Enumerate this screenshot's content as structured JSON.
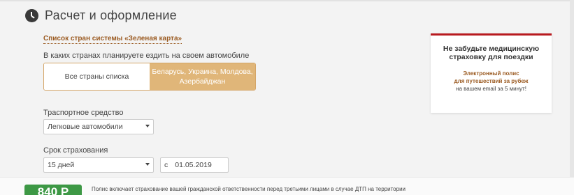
{
  "header": {
    "icon": "clock-icon",
    "title": "Расчет и оформление"
  },
  "countries_link": "Список стран системы «Зеленая карта»",
  "countries": {
    "label": "В каких странах планируете ездить на своем автомобиле",
    "options": [
      "Все страны списка",
      "Беларусь, Украина, Молдова, Азербайджан"
    ],
    "selected_index": 1
  },
  "vehicle": {
    "label": "Траспортное средство",
    "value": "Легковые автомобили"
  },
  "period": {
    "label": "Срок страхования",
    "value": "15 дней",
    "date_prefix": "с",
    "date_value": "01.05.2019"
  },
  "promo": {
    "title": "Не забудьте медицинскую страховку для поездки",
    "line1": "Электронный полис",
    "line2": "для путешествий за рубеж",
    "line3": "на вашем email за 5 минут!"
  },
  "footer": {
    "price": "840 Р",
    "note": "Полис включает страхование вашей гражданской ответственности перед третьими лицами в случае ДТП на территории"
  },
  "colors": {
    "accent": "#e0b679",
    "link": "#9b5b22",
    "promo_border": "#b81a1f",
    "price_bg": "#3d9845"
  }
}
